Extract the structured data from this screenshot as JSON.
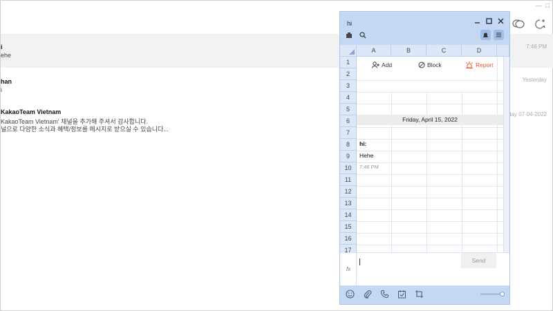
{
  "main": {
    "chats": [
      {
        "name": "i",
        "message": "ehe",
        "time": "7:46 PM",
        "selected": true
      },
      {
        "name": "han",
        "message": "i",
        "time": "Yesterday",
        "selected": false
      },
      {
        "name": "KakaoTeam Vietnam",
        "message": "KakaoTeam Vietnam' 채널을 추가해 주셔서 감사합니다.",
        "message2": "널으로 다양한 소식과 혜택/정보를 메시지로 받으실 수 있습니다...",
        "time": "day 07-04-2022",
        "selected": false
      }
    ]
  },
  "chat_window": {
    "title": "hi",
    "columns": [
      "A",
      "B",
      "C",
      "D"
    ],
    "rows": [
      "1",
      "2",
      "3",
      "4",
      "5",
      "6",
      "7",
      "8",
      "9",
      "10",
      "11",
      "12",
      "13",
      "14",
      "15",
      "16",
      "17"
    ],
    "actions": {
      "add": "Add",
      "block": "Block",
      "report": "Report"
    },
    "date": "Friday, April 15, 2022",
    "sender": "hi:",
    "message": "Hehe",
    "message_time": "7:46 PM",
    "fx_label": "fx",
    "send_label": "Send"
  },
  "colors": {
    "accent": "#c4d8f3",
    "report": "#e8512a",
    "header": "#dce8f7"
  }
}
